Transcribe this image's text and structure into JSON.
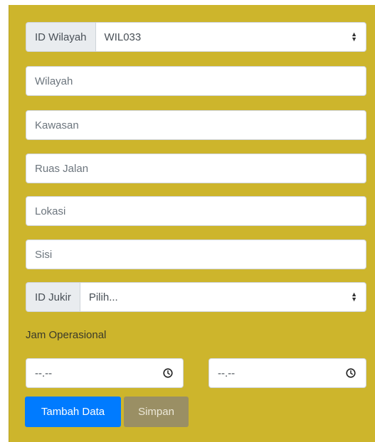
{
  "form": {
    "id_wilayah": {
      "label": "ID Wilayah",
      "value": "WIL033"
    },
    "wilayah": {
      "placeholder": "Wilayah"
    },
    "kawasan": {
      "placeholder": "Kawasan"
    },
    "ruas_jalan": {
      "placeholder": "Ruas Jalan"
    },
    "lokasi": {
      "placeholder": "Lokasi"
    },
    "sisi": {
      "placeholder": "Sisi"
    },
    "id_jukir": {
      "label": "ID Jukir",
      "value": "Pilih..."
    },
    "jam_operasional": {
      "label": "Jam Operasional",
      "start_value": "--.--",
      "end_value": "--.--"
    }
  },
  "buttons": {
    "tambah": "Tambah Data",
    "simpan": "Simpan"
  },
  "colors": {
    "panel": "#cdb52c",
    "primary": "#007bff",
    "secondary_disabled": "#9a8f64"
  },
  "icons": {
    "select_caret": "select-caret-icon",
    "clock": "clock-icon"
  }
}
